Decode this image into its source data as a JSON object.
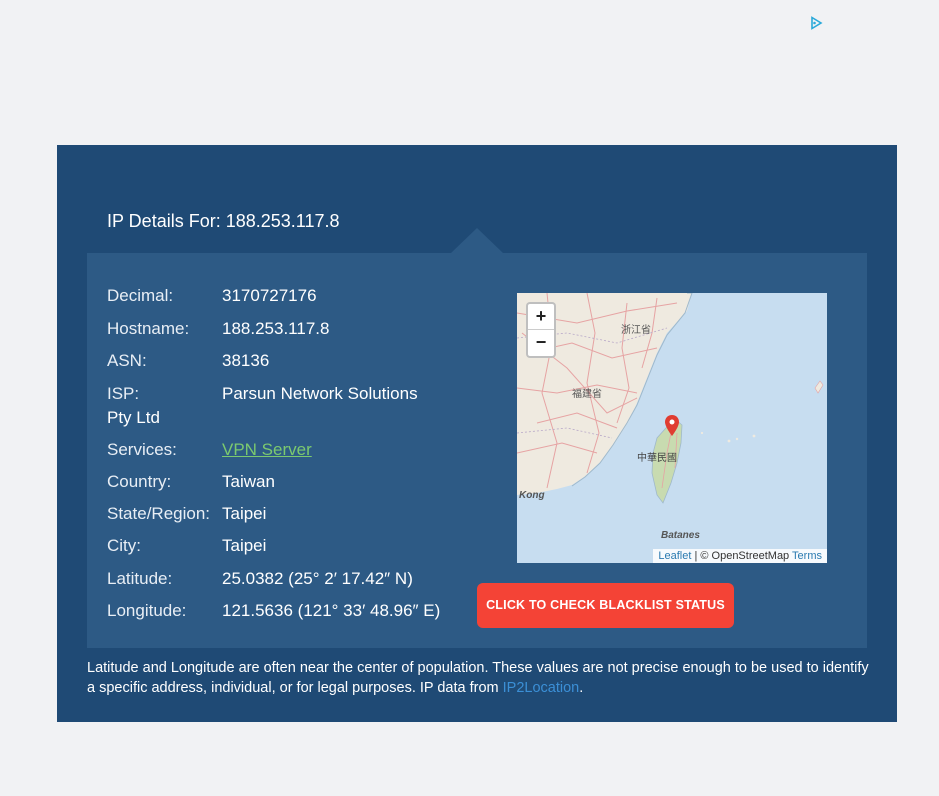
{
  "ad": {
    "icon": "ad-choices-icon"
  },
  "panel": {
    "title": "IP Details For: 188.253.117.8"
  },
  "details": {
    "decimal": {
      "label": "Decimal:",
      "value": "3170727176"
    },
    "hostname": {
      "label": "Hostname:",
      "value": "188.253.117.8"
    },
    "asn": {
      "label": "ASN:",
      "value": "38136"
    },
    "isp": {
      "label": "ISP:",
      "value_line1": "Parsun Network Solutions",
      "value_line2": "Pty Ltd"
    },
    "services": {
      "label": "Services:",
      "value": "VPN Server"
    },
    "country": {
      "label": "Country:",
      "value": "Taiwan"
    },
    "state": {
      "label": "State/Region:",
      "value": "Taipei"
    },
    "city": {
      "label": "City:",
      "value": "Taipei"
    },
    "latitude": {
      "label": "Latitude:",
      "value": "25.0382 (25° 2′ 17.42″ N)"
    },
    "longitude": {
      "label": "Longitude:",
      "value": "121.5636 (121° 33′ 48.96″ E)"
    }
  },
  "map": {
    "zoom_in": "+",
    "zoom_out": "−",
    "labels": {
      "zhejiang": "浙江省",
      "fujian": "福建省",
      "taiwan": "中華民國",
      "kong": "Kong",
      "batanes": "Batanes"
    },
    "attribution": {
      "leaflet": "Leaflet",
      "sep": " | © OpenStreetMap ",
      "terms": "Terms"
    },
    "marker_color": "#e03c31"
  },
  "actions": {
    "blacklist_button": "CLICK TO CHECK BLACKLIST STATUS"
  },
  "footnote": {
    "text": "Latitude and Longitude are often near the center of population. These values are not precise enough to be used to identify a specific address, individual, or for legal purposes. IP data from ",
    "source": "IP2Location",
    "end": "."
  },
  "colors": {
    "page_bg": "#f1f2f4",
    "panel_bg": "#1f4a75",
    "inner_bg": "#2d5a85",
    "button_bg": "#f44336",
    "link_green": "#7bc96f",
    "link_blue": "#3b8fd6"
  }
}
